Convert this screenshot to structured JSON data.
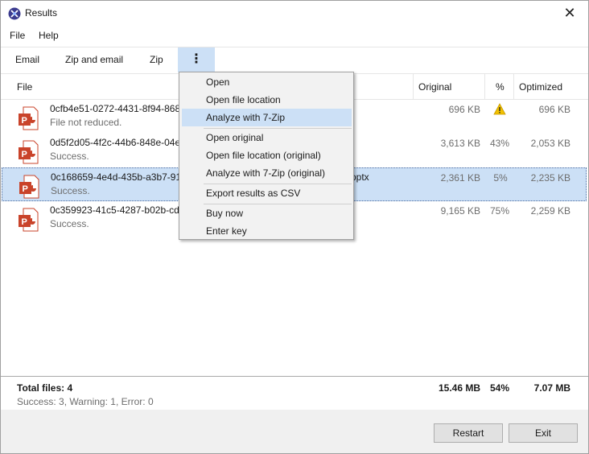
{
  "window": {
    "title": "Results",
    "close_glyph": "✕"
  },
  "menubar": {
    "items": [
      "File",
      "Help"
    ]
  },
  "toolbar": {
    "email": "Email",
    "zip_email": "Zip and email",
    "zip": "Zip",
    "more": "⋮"
  },
  "columns": {
    "file": "File",
    "original": "Original",
    "percent": "%",
    "optimized": "Optimized"
  },
  "rows": [
    {
      "name": "0cfb4e51-0272-4431-8f94-868c",
      "status": "File not reduced.",
      "original": "696 KB",
      "percent": "",
      "optimized": "696 KB",
      "warning": true
    },
    {
      "name": "0d5f2d05-4f2c-44b6-848e-04e",
      "status": "Success.",
      "original": "3,613 KB",
      "percent": "43%",
      "optimized": "2,053 KB"
    },
    {
      "name": "0c168659-4e4d-435b-a3b7-912",
      "name_tail": "pptx",
      "status": "Success.",
      "original": "2,361 KB",
      "percent": "5%",
      "optimized": "2,235 KB",
      "selected": true
    },
    {
      "name": "0c359923-41c5-4287-b02b-cd6",
      "status": "Success.",
      "original": "9,165 KB",
      "percent": "75%",
      "optimized": "2,259 KB"
    }
  ],
  "footer": {
    "total": "Total files: 4",
    "summary": "Success: 3, Warning: 1, Error: 0",
    "total_original": "15.46 MB",
    "total_percent": "54%",
    "total_optimized": "7.07 MB"
  },
  "buttons": {
    "restart": "Restart",
    "exit": "Exit"
  },
  "context_menu": {
    "open": "Open",
    "open_location": "Open file location",
    "analyze": "Analyze with 7-Zip",
    "open_original": "Open original",
    "open_location_original": "Open file location (original)",
    "analyze_original": "Analyze with 7-Zip (original)",
    "export_csv": "Export results as CSV",
    "buy_now": "Buy now",
    "enter_key": "Enter key"
  },
  "colors": {
    "accent": "#cce0f6",
    "ppt_red": "#c9432a",
    "warning": "#f2c100"
  }
}
